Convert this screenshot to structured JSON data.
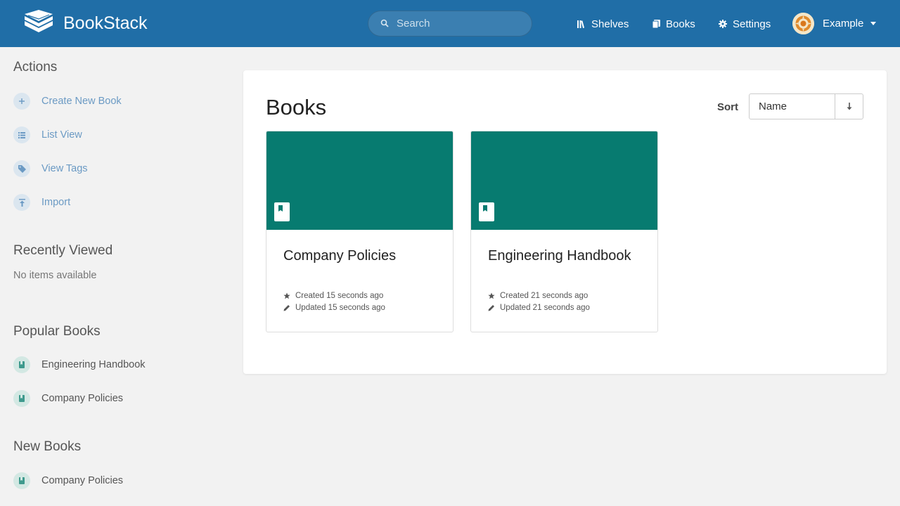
{
  "header": {
    "app_name": "BookStack",
    "search_placeholder": "Search",
    "nav": [
      {
        "label": "Shelves",
        "icon": "shelves-icon"
      },
      {
        "label": "Books",
        "icon": "books-icon"
      },
      {
        "label": "Settings",
        "icon": "gear-icon"
      }
    ],
    "user_name": "Example"
  },
  "sidebar": {
    "actions_title": "Actions",
    "actions": [
      {
        "label": "Create New Book",
        "icon": "plus-icon"
      },
      {
        "label": "List View",
        "icon": "list-icon"
      },
      {
        "label": "View Tags",
        "icon": "tag-icon"
      },
      {
        "label": "Import",
        "icon": "upload-icon"
      }
    ],
    "recent_title": "Recently Viewed",
    "recent_empty": "No items available",
    "popular_title": "Popular Books",
    "popular": [
      {
        "label": "Engineering Handbook",
        "icon": "book-icon"
      },
      {
        "label": "Company Policies",
        "icon": "book-icon"
      }
    ],
    "new_title": "New Books",
    "new_books": [
      {
        "label": "Company Policies",
        "icon": "book-icon"
      }
    ]
  },
  "main": {
    "title": "Books",
    "sort_label": "Sort",
    "sort_value": "Name",
    "sort_direction_icon": "arrow-down-icon",
    "books": [
      {
        "title": "Company Policies",
        "created": "Created 15 seconds ago",
        "updated": "Updated 15 seconds ago"
      },
      {
        "title": "Engineering Handbook",
        "created": "Created 21 seconds ago",
        "updated": "Updated 21 seconds ago"
      }
    ]
  },
  "colors": {
    "header": "#206ea7",
    "book_cover": "#077b70",
    "action_link": "#6b9ac4",
    "background": "#f2f2f2"
  }
}
